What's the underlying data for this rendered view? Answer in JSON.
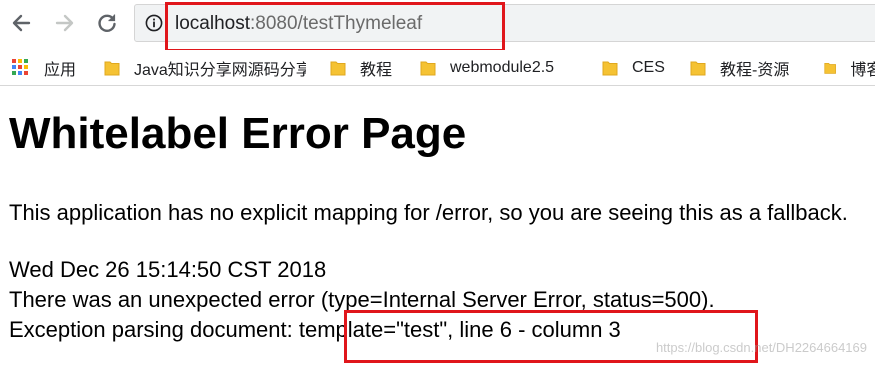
{
  "browser": {
    "url_host": "localhost",
    "url_rest": ":8080/testThymeleaf",
    "back_icon": "back-arrow-icon",
    "forward_icon": "forward-arrow-icon",
    "reload_icon": "reload-icon",
    "info_icon": "info-icon",
    "highlight_color": "#e0161b"
  },
  "bookmarks": {
    "apps_label": "应用",
    "items": [
      "Java知识分享网源码分享",
      "教程",
      "webmodule2.5",
      "CES",
      "教程-资源",
      "博客"
    ]
  },
  "page": {
    "title": "Whitelabel Error Page",
    "description": "This application has no explicit mapping for /error, so you are seeing this as a fallback.",
    "timestamp": "Wed Dec 26 15:14:50 CST 2018",
    "error_line": "There was an unexpected error (type=Internal Server Error, status=500).",
    "exception_prefix": "Exception parsing document: ",
    "exception_detail": "template=\"test\", line 6 - column 3"
  },
  "watermark": "https://blog.csdn.net/DH2264664169"
}
